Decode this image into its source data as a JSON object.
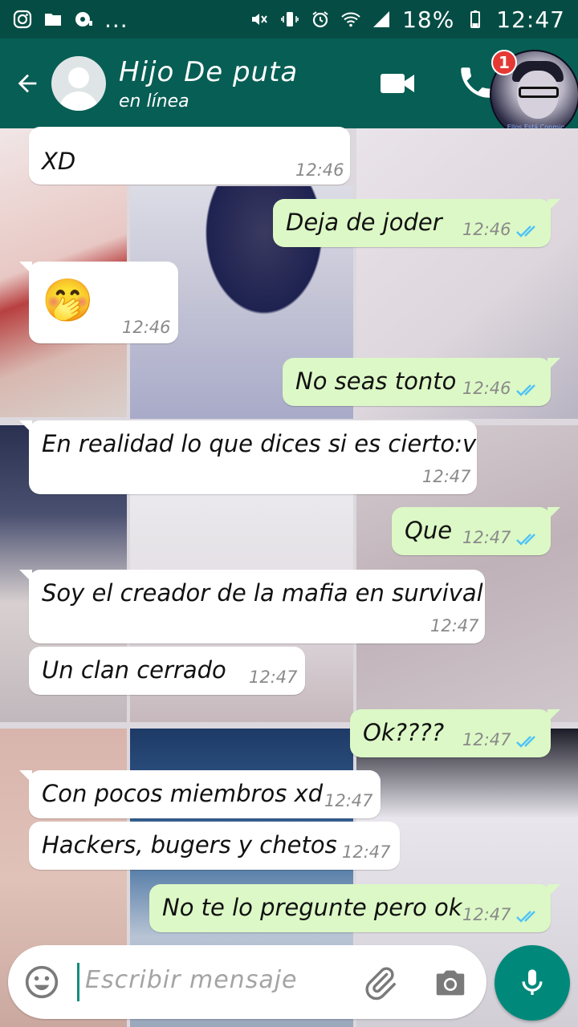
{
  "status_bar": {
    "battery": "18%",
    "time": "12:47",
    "overflow": "..."
  },
  "header": {
    "contact_name": "Hijo De puta",
    "status": "en línea",
    "notification_count": "1",
    "bubble_caption": "Ellos Está Conmigo"
  },
  "messages": [
    {
      "dir": "in",
      "text": "XD",
      "time": "12:46"
    },
    {
      "dir": "out",
      "text": "Deja de joder",
      "time": "12:46"
    },
    {
      "dir": "in",
      "text": "🤭",
      "time": "12:46"
    },
    {
      "dir": "out",
      "text": "No seas tonto",
      "time": "12:46"
    },
    {
      "dir": "in",
      "text": "En realidad lo que dices si es cierto:v",
      "time": "12:47"
    },
    {
      "dir": "out",
      "text": "Que",
      "time": "12:47"
    },
    {
      "dir": "in",
      "text": "Soy el creador de la mafia en survival",
      "time": "12:47"
    },
    {
      "dir": "in",
      "text": "Un clan cerrado",
      "time": "12:47"
    },
    {
      "dir": "out",
      "text": "Ok????",
      "time": "12:47"
    },
    {
      "dir": "in",
      "text": "Con pocos miembros xd",
      "time": "12:47"
    },
    {
      "dir": "in",
      "text": "Hackers, bugers y chetos",
      "time": "12:47"
    },
    {
      "dir": "out",
      "text": "No te lo pregunte pero ok",
      "time": "12:47"
    }
  ],
  "composer": {
    "placeholder": "Escribir mensaje"
  },
  "colors": {
    "header": "#075e54",
    "statusbar": "#054d44",
    "outgoing": "#dcf8c6",
    "incoming": "#ffffff",
    "read_ticks": "#4fc3f7",
    "mic": "#00897b"
  }
}
